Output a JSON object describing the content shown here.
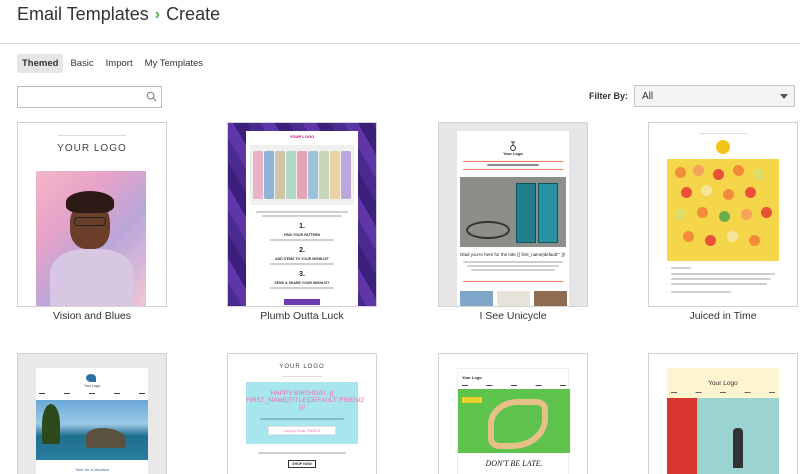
{
  "header": {
    "breadcrumb_root": "Email Templates",
    "breadcrumb_separator": "›",
    "breadcrumb_current": "Create"
  },
  "tabs": [
    {
      "label": "Themed",
      "active": true
    },
    {
      "label": "Basic",
      "active": false
    },
    {
      "label": "Import",
      "active": false
    },
    {
      "label": "My Templates",
      "active": false
    }
  ],
  "search": {
    "value": "",
    "placeholder": ""
  },
  "filter": {
    "label": "Filter By:",
    "selected": "All"
  },
  "colors": {
    "accent_green": "#4caf50",
    "tab_active_bg": "#e6e6e6"
  },
  "templates": [
    {
      "name": "Vision and Blues",
      "preview_logo": "YOUR LOGO"
    },
    {
      "name": "Plumb Outta Luck",
      "preview_logo": "YOUR LOGO",
      "steps": [
        {
          "num": "1.",
          "text": "FIND YOUR PATTERN"
        },
        {
          "num": "2.",
          "text": "ADD ITEMS TO YOUR WISHLIST"
        },
        {
          "num": "3.",
          "text": "SEND & SHARE YOUR WISHLIST"
        }
      ]
    },
    {
      "name": "I See Unicycle",
      "preview_logo": "Your Logo",
      "headline": "Glad you're here for the ride {{ first_name|default:'' }}!"
    },
    {
      "name": "Juiced in Time"
    },
    {
      "preview_logo": "Your Logo",
      "caption": "Time for a Vacation"
    },
    {
      "preview_logo": "YOUR LOGO",
      "greeting": "HAPPY BIRTHDAY, {{ FIRST_NAME|TITLE|DEFAULT:'FRIEND' }}!",
      "code": "Coupon Code: TWDCO",
      "button": "SHOP NOW"
    },
    {
      "preview_logo": "Your Logo",
      "tagline": "DON'T BE LATE."
    },
    {
      "preview_logo": "Your Logo"
    }
  ]
}
